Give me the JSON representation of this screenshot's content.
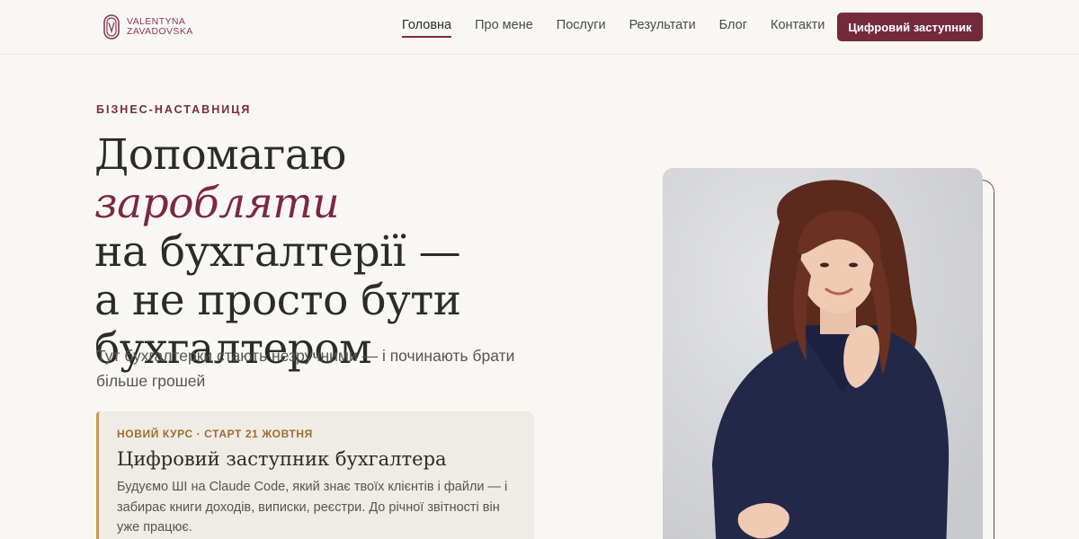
{
  "brand": {
    "name_line1": "VALENTYNA",
    "name_line2": "ZAVADOVSKA",
    "accent_color": "#732b3c",
    "gold_color": "#c49a55"
  },
  "nav": {
    "items": [
      {
        "label": "Головна",
        "active": true
      },
      {
        "label": "Про мене",
        "active": false
      },
      {
        "label": "Послуги",
        "active": false
      },
      {
        "label": "Результати",
        "active": false
      },
      {
        "label": "Блог",
        "active": false
      },
      {
        "label": "Контакти",
        "active": false
      }
    ],
    "cta_label": "Цифровий заступник"
  },
  "hero": {
    "eyebrow": "БІЗНЕС-НАСТАВНИЦЯ",
    "headline_part1": "Допомагаю ",
    "headline_accent": "заробляти",
    "headline_line2": "на бухгалтерії —",
    "headline_line3": "а не просто бути",
    "headline_line4": "бухгалтером",
    "lead": "Тут бухгалтерки стають незручними — і починають брати більше грошей"
  },
  "course_card": {
    "tag": "НОВИЙ КУРС · СТАРТ 21 ЖОВТНЯ",
    "title": "Цифровий заступник бухгалтера",
    "description": "Будуємо ШІ на Claude Code, який знає твоїх клієнтів і файли — і забирає книги доходів, виписки, реєстри. До річної звітності він уже працює."
  },
  "photo": {
    "icon": "portrait-photo"
  }
}
